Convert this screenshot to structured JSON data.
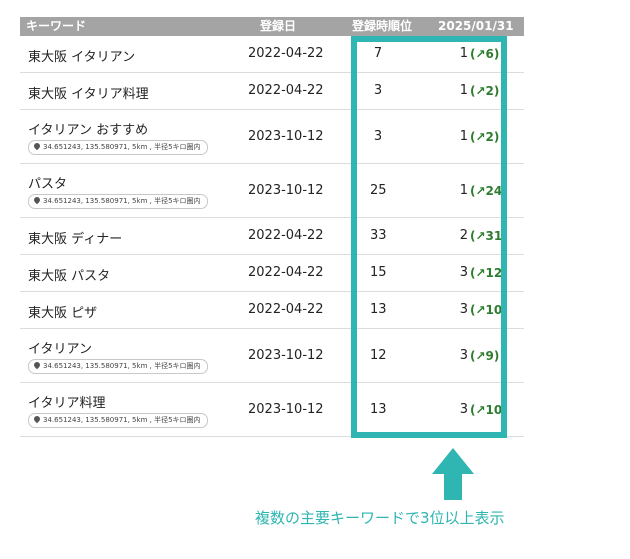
{
  "header": {
    "keyword": "キーワード",
    "registered": "登録日",
    "initial_rank": "登録時順位",
    "date": "2025/01/31"
  },
  "rows": [
    {
      "keyword": "東大阪 イタリアン",
      "location": "",
      "date": "2022-04-22",
      "initial_rank": "7",
      "rank": "1",
      "change": "(↗6)"
    },
    {
      "keyword": "東大阪 イタリア料理",
      "location": "",
      "date": "2022-04-22",
      "initial_rank": "3",
      "rank": "1",
      "change": "(↗2)"
    },
    {
      "keyword": "イタリアン おすすめ",
      "location": "34.651243, 135.580971, 5km , 半径5キロ圏内",
      "date": "2023-10-12",
      "initial_rank": "3",
      "rank": "1",
      "change": "(↗2)"
    },
    {
      "keyword": "パスタ",
      "location": "34.651243, 135.580971, 5km , 半径5キロ圏内",
      "date": "2023-10-12",
      "initial_rank": "25",
      "rank": "1",
      "change": "(↗24)"
    },
    {
      "keyword": "東大阪 ディナー",
      "location": "",
      "date": "2022-04-22",
      "initial_rank": "33",
      "rank": "2",
      "change": "(↗31)"
    },
    {
      "keyword": "東大阪 パスタ",
      "location": "",
      "date": "2022-04-22",
      "initial_rank": "15",
      "rank": "3",
      "change": "(↗12)"
    },
    {
      "keyword": "東大阪 ピザ",
      "location": "",
      "date": "2022-04-22",
      "initial_rank": "13",
      "rank": "3",
      "change": "(↗10)"
    },
    {
      "keyword": "イタリアン",
      "location": "34.651243, 135.580971, 5km , 半径5キロ圏内",
      "date": "2023-10-12",
      "initial_rank": "12",
      "rank": "3",
      "change": "(↗9)"
    },
    {
      "keyword": "イタリア料理",
      "location": "34.651243, 135.580971, 5km , 半径5キロ圏内",
      "date": "2023-10-12",
      "initial_rank": "13",
      "rank": "3",
      "change": "(↗10)"
    }
  ],
  "callout": "複数の主要キーワードで3位以上表示",
  "colors": {
    "accent": "#2fb5b2",
    "header_bg": "#a4a4a4",
    "positive_change": "#2e7d2e"
  },
  "icons": {
    "location": "map-pin-icon",
    "arrow": "up-arrow-icon"
  }
}
